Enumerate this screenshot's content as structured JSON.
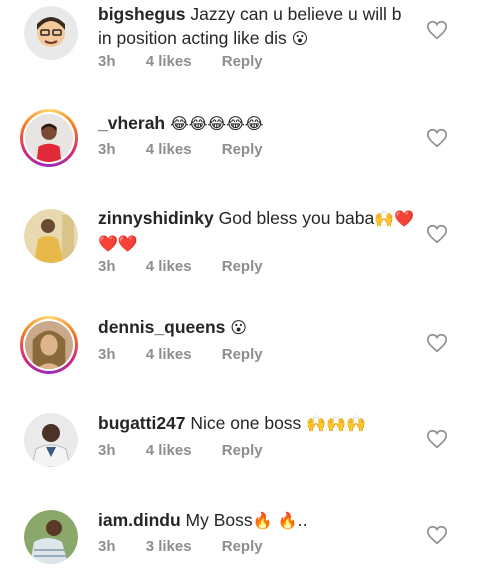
{
  "comments": [
    {
      "username": "bigshegus",
      "text": "Jazzy can u believe u will b in position acting like dis",
      "emoji": "😮",
      "time": "3h",
      "likes": "4 likes",
      "reply": "Reply"
    },
    {
      "username": "_vherah",
      "text": "",
      "emoji": "😂😂😂😂😂",
      "time": "3h",
      "likes": "4 likes",
      "reply": "Reply"
    },
    {
      "username": "zinnyshidinky",
      "text": "God bless you baba",
      "emoji": "🙌❤️ ❤️❤️",
      "time": "3h",
      "likes": "4 likes",
      "reply": "Reply"
    },
    {
      "username": "dennis_queens",
      "text": "",
      "emoji": "😮",
      "time": "3h",
      "likes": "4 likes",
      "reply": "Reply"
    },
    {
      "username": "bugatti247",
      "text": "Nice one boss",
      "emoji": "🙌🙌🙌",
      "time": "3h",
      "likes": "4 likes",
      "reply": "Reply"
    },
    {
      "username": "iam.dindu",
      "text": "My Boss",
      "emoji": "🔥 🔥..",
      "time": "3h",
      "likes": "3 likes",
      "reply": "Reply"
    }
  ],
  "icons": {
    "like": "heart-outline-icon"
  },
  "colors": {
    "meta": "#8e8e8e",
    "text": "#262626",
    "emoji_red": "#e0245e",
    "emoji_yellow": "#f5c518"
  }
}
